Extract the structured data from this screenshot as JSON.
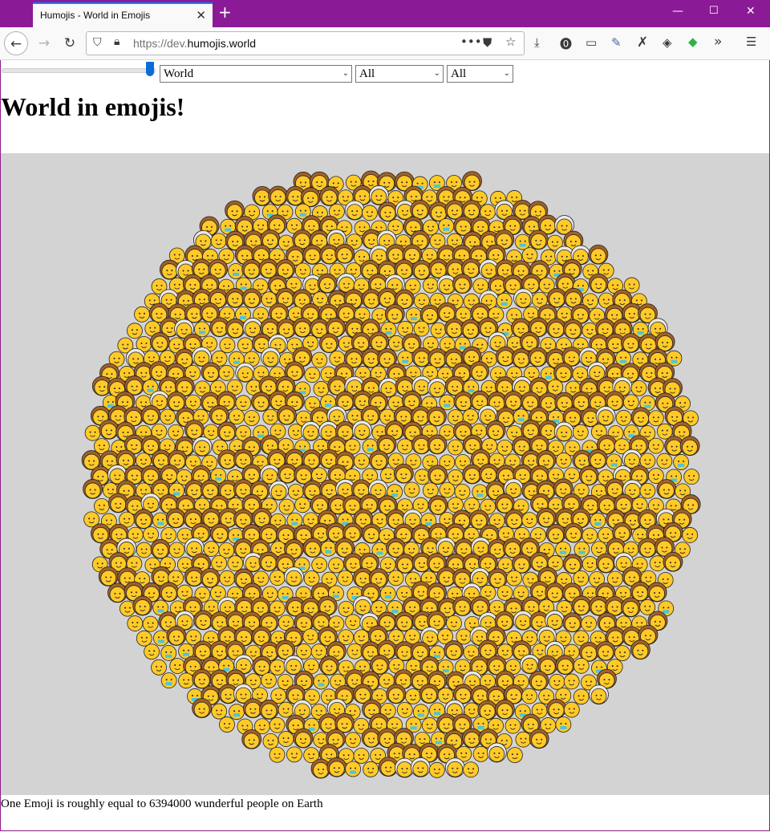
{
  "browser": {
    "tab_title": "Humojis - World in Emojis",
    "url_prefix": "https://dev.",
    "url_domain": "humojis.world"
  },
  "controls": {
    "slider_level": 0.98,
    "region": "World",
    "filter1": "All",
    "filter2": "All"
  },
  "page": {
    "heading": "World in emojis!",
    "footer": "One Emoji is roughly equal to 6394000 wunderful people on Earth"
  },
  "colors": {
    "chrome_accent": "#8a1a96",
    "canvas_bg": "#d3d3d3",
    "skin": "#ffca28",
    "hair": "#a0612a",
    "white_hair": "#e8e8e8",
    "mask": "#4fc3d9"
  },
  "icons": [
    "back-icon",
    "forward-icon",
    "reload-icon",
    "shield-icon",
    "lock-icon",
    "more-icon",
    "pocket-icon",
    "star-icon",
    "download-icon",
    "privacy-icon",
    "sync-icon",
    "eyedropper-icon",
    "x-icon",
    "layers-icon",
    "extension-icon",
    "overflow-icon",
    "menu-icon"
  ]
}
